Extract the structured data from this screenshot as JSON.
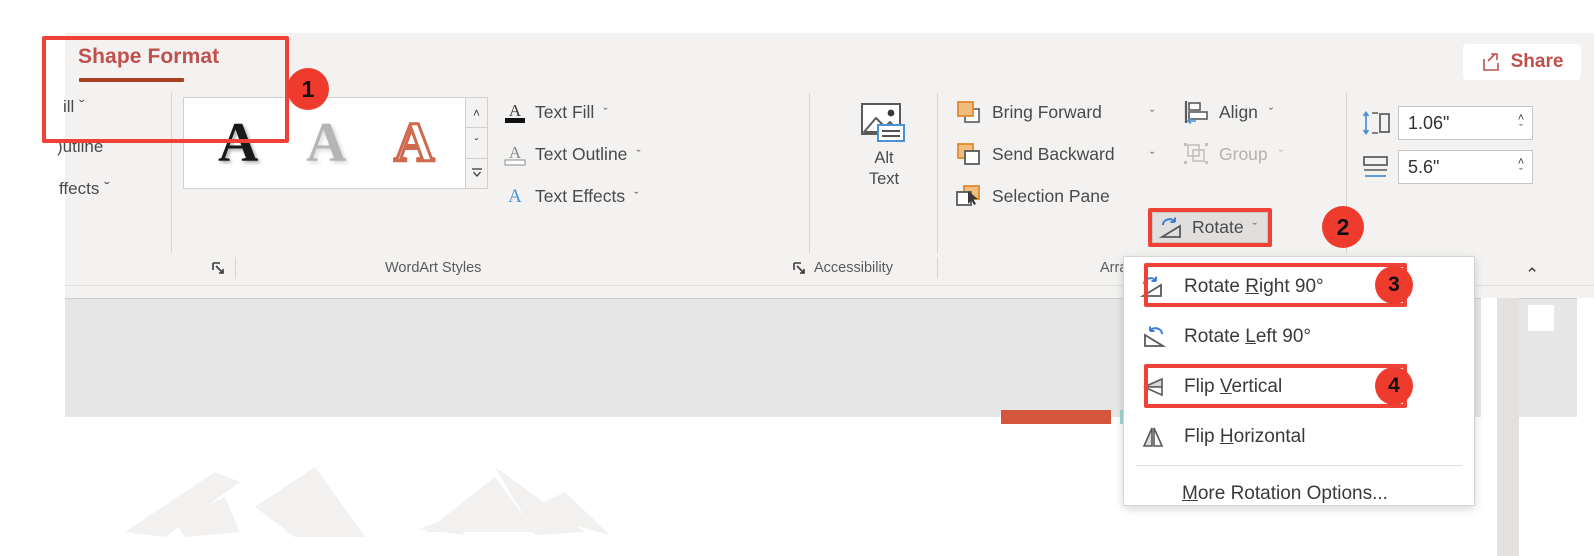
{
  "ribbon": {
    "active_tab": "Shape Format",
    "share_button": "Share",
    "share_icon": "share-icon"
  },
  "shape_styles_truncated": [
    {
      "label": "ill ˇ",
      "name": "shape-fill-button"
    },
    {
      "label": ")utline ˇ",
      "name": "shape-outline-button"
    },
    {
      "label": "ffects ˇ",
      "name": "shape-effects-button"
    }
  ],
  "wordart": {
    "gallery_items": [
      {
        "letter": "A",
        "style": "black-shadow"
      },
      {
        "letter": "A",
        "style": "gray-shadow"
      },
      {
        "letter": "A",
        "style": "red-outline"
      }
    ],
    "scroll_up": "˄",
    "scroll_down": "ˇ",
    "scroll_more": "☰",
    "text_options": [
      {
        "label": "Text Fill",
        "chevron": "ˇ",
        "icon": "text-fill-icon"
      },
      {
        "label": "Text Outline",
        "chevron": "ˇ",
        "icon": "text-outline-icon"
      },
      {
        "label": "Text Effects",
        "chevron": "ˇ",
        "icon": "text-effects-icon"
      }
    ]
  },
  "accessibility": {
    "alt_text_line1": "Alt",
    "alt_text_line2": "Text",
    "icon": "alt-text-image-icon"
  },
  "arrange": {
    "order_items": [
      {
        "label": "Bring Forward",
        "chevron": "ˇ",
        "icon": "bring-forward-icon",
        "disabled": false
      },
      {
        "label": "Send Backward",
        "chevron": "ˇ",
        "icon": "send-backward-icon",
        "disabled": false
      },
      {
        "label": "Selection Pane",
        "chevron": "",
        "icon": "selection-pane-icon",
        "disabled": false
      }
    ],
    "align_items": [
      {
        "label": "Align",
        "chevron": "ˇ",
        "icon": "align-icon",
        "disabled": false
      },
      {
        "label": "Group",
        "chevron": "ˇ",
        "icon": "group-icon",
        "disabled": true
      }
    ],
    "rotate_button": {
      "label": "Rotate",
      "chevron": "ˇ",
      "icon": "rotate-icon"
    }
  },
  "size": {
    "height": {
      "value": "1.06\"",
      "icon": "shape-height-icon"
    },
    "width": {
      "value": "5.6\"",
      "icon": "shape-width-icon"
    },
    "spin_up": "˄",
    "spin_down": "ˇ"
  },
  "group_labels": [
    {
      "label": "WordArt Styles",
      "name": "group-label-wordart-styles"
    },
    {
      "label": "Accessibility",
      "name": "group-label-accessibility"
    },
    {
      "label": "Arrange",
      "name": "group-label-arrange"
    }
  ],
  "collapse_ribbon_chevron": "⌃",
  "rotate_menu": {
    "items": [
      {
        "pre": "Rotate ",
        "key": "R",
        "post": "ight 90°",
        "icon": "rotate-right-90-icon",
        "separator_after": false
      },
      {
        "pre": "Rotate ",
        "key": "L",
        "post": "eft 90°",
        "icon": "rotate-left-90-icon",
        "separator_after": false
      },
      {
        "pre": "Flip ",
        "key": "V",
        "post": "ertical",
        "icon": "flip-vertical-icon",
        "separator_after": false
      },
      {
        "pre": "Flip ",
        "key": "H",
        "post": "orizontal",
        "icon": "flip-horizontal-icon",
        "separator_after": true
      }
    ],
    "more_options": {
      "pre": "",
      "key": "M",
      "post": "ore Rotation Options..."
    }
  },
  "annotations": {
    "badges": [
      {
        "number": "1",
        "name": "annotation-badge-1"
      },
      {
        "number": "2",
        "name": "annotation-badge-2"
      },
      {
        "number": "3",
        "name": "annotation-badge-3"
      },
      {
        "number": "4",
        "name": "annotation-badge-4"
      }
    ],
    "color": "#ee3b2e"
  },
  "colors": {
    "ribbon_bg": "#f3f2f1",
    "accent_tab": "#c0504d",
    "annotation_red": "#ef4136",
    "slide_bar_orange": "#d4563c",
    "slide_bar_teal": "#9fd6d2"
  }
}
